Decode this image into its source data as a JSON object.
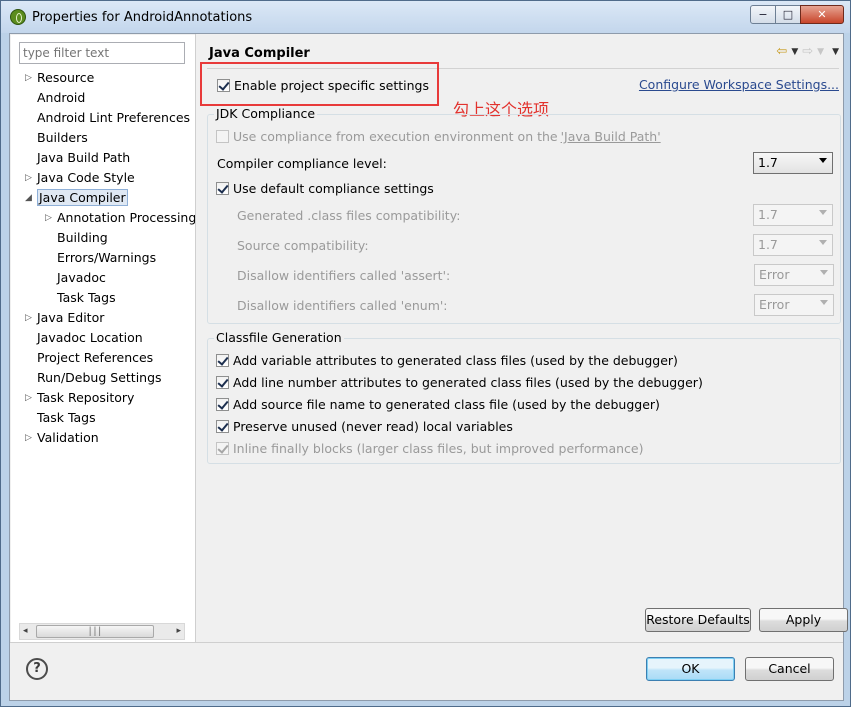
{
  "window": {
    "title": "Properties for AndroidAnnotations",
    "minimize_icon": "minimize-icon",
    "maximize_icon": "maximize-icon",
    "close_icon": "close-icon"
  },
  "filter": {
    "placeholder": "type filter text"
  },
  "tree": [
    {
      "label": "Resource",
      "expandable": true
    },
    {
      "label": "Android",
      "expandable": false
    },
    {
      "label": "Android Lint Preferences",
      "expandable": false
    },
    {
      "label": "Builders",
      "expandable": false
    },
    {
      "label": "Java Build Path",
      "expandable": false
    },
    {
      "label": "Java Code Style",
      "expandable": true
    },
    {
      "label": "Java Compiler",
      "expandable": true,
      "expanded": true,
      "selected": true
    },
    {
      "label": "Annotation Processing",
      "expandable": true,
      "indent": 1
    },
    {
      "label": "Building",
      "indent": 1
    },
    {
      "label": "Errors/Warnings",
      "indent": 1
    },
    {
      "label": "Javadoc",
      "indent": 1
    },
    {
      "label": "Task Tags",
      "indent": 1
    },
    {
      "label": "Java Editor",
      "expandable": true
    },
    {
      "label": "Javadoc Location"
    },
    {
      "label": "Project References"
    },
    {
      "label": "Run/Debug Settings"
    },
    {
      "label": "Task Repository",
      "expandable": true
    },
    {
      "label": "Task Tags"
    },
    {
      "label": "Validation",
      "expandable": true
    }
  ],
  "page": {
    "title": "Java Compiler",
    "enable_project_specific": "Enable project specific settings",
    "configure_workspace": "Configure Workspace Settings...",
    "annotation": "勾上这个选项",
    "jdk": {
      "label": "JDK Compliance",
      "use_env_pre": "Use compliance from execution environment on the ",
      "use_env_link": "'Java Build Path'",
      "compliance_level_label": "Compiler compliance level:",
      "compliance_level_value": "1.7",
      "use_default": "Use default compliance settings",
      "generated_label": "Generated .class files compatibility:",
      "generated_value": "1.7",
      "source_label": "Source compatibility:",
      "source_value": "1.7",
      "assert_label": "Disallow identifiers called 'assert':",
      "assert_value": "Error",
      "enum_label": "Disallow identifiers called 'enum':",
      "enum_value": "Error"
    },
    "classfile": {
      "label": "Classfile Generation",
      "items": [
        {
          "label": "Add variable attributes to generated class files (used by the debugger)",
          "checked": true,
          "disabled": false
        },
        {
          "label": "Add line number attributes to generated class files (used by the debugger)",
          "checked": true,
          "disabled": false
        },
        {
          "label": "Add source file name to generated class file (used by the debugger)",
          "checked": true,
          "disabled": false
        },
        {
          "label": "Preserve unused (never read) local variables",
          "checked": true,
          "disabled": false
        },
        {
          "label": "Inline finally blocks (larger class files, but improved performance)",
          "checked": true,
          "disabled": true
        }
      ]
    },
    "restore_defaults": "Restore Defaults",
    "apply": "Apply"
  },
  "footer": {
    "help": "?",
    "ok": "OK",
    "cancel": "Cancel"
  },
  "colors": {
    "annotation": "#e2322d",
    "link": "#2a4a8f",
    "selection": "#dfe8f3"
  }
}
